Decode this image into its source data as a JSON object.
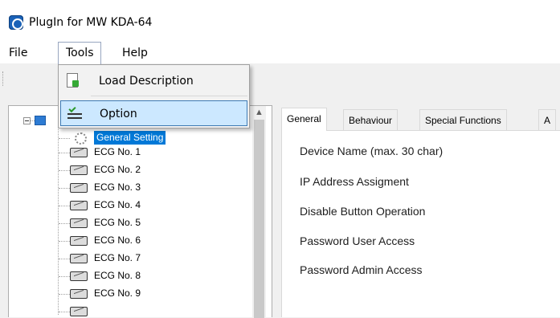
{
  "window": {
    "title": "PlugIn for MW KDA-64"
  },
  "menu": {
    "items": [
      "File",
      "Tools",
      "Help"
    ],
    "open": "Tools",
    "dropdown": [
      {
        "label": "Load Description",
        "icon": "document-load-icon"
      },
      {
        "label": "Option",
        "icon": "option-list-icon",
        "highlighted": true
      }
    ]
  },
  "tree": {
    "selected": "General Setting",
    "items": [
      "General Setting",
      "ECG No. 1",
      "ECG No. 2",
      "ECG No. 3",
      "ECG No. 4",
      "ECG No. 5",
      "ECG No. 6",
      "ECG No. 7",
      "ECG No. 8",
      "ECG No. 9"
    ]
  },
  "tabs": [
    "General",
    "Behaviour",
    "Special Functions",
    "A"
  ],
  "active_tab": "General",
  "general": {
    "fields": [
      "Device Name (max. 30 char)",
      "IP Address Assigment",
      "Disable Button Operation",
      "Password User Access",
      "Password Admin Access"
    ]
  },
  "colors": {
    "selection": "#0078d7",
    "menu_highlight": "#cce8ff"
  }
}
